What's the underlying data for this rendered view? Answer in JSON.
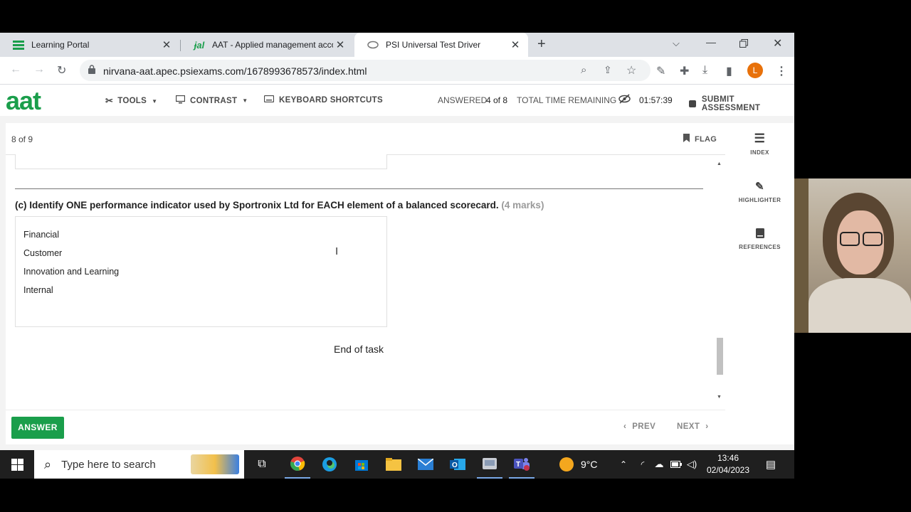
{
  "browser": {
    "tabs": [
      {
        "title": "Learning Portal",
        "active": false
      },
      {
        "title": "AAT - Applied management acco",
        "active": false
      },
      {
        "title": "PSI Universal Test Driver",
        "active": true
      }
    ],
    "url": "nirvana-aat.apec.psiexams.com/1678993678573/index.html",
    "profile_initial": "L"
  },
  "app": {
    "logo": "aat",
    "tools_label": "TOOLS",
    "contrast_label": "CONTRAST",
    "shortcuts_label": "KEYBOARD SHORTCUTS",
    "answered_label": "ANSWERED",
    "answered_value": "4 of 8",
    "time_label": "TOTAL TIME REMAINING",
    "time_value": "01:57:39",
    "submit_label": "SUBMIT ASSESSMENT"
  },
  "question": {
    "counter": "8 of 9",
    "flag_label": "FLAG",
    "prompt": "(c) Identify ONE performance indicator used by Sportronix Ltd for EACH element of a balanced scorecard.",
    "marks": "(4 marks)",
    "answer_lines": [
      "Financial",
      "Customer",
      "Innovation and Learning",
      "Internal"
    ],
    "end_text": "End of task"
  },
  "sidebar": {
    "index_label": "INDEX",
    "highlighter_label": "HIGHLIGHTER",
    "references_label": "REFERENCES"
  },
  "footer": {
    "answer_label": "ANSWER",
    "prev_label": "PREV",
    "next_label": "NEXT"
  },
  "taskbar": {
    "search_placeholder": "Type here to search",
    "temperature": "9°C",
    "time": "13:46",
    "date": "02/04/2023"
  },
  "colors": {
    "brand_green": "#1a9e4b",
    "answer_button": "#1a9e4b"
  }
}
